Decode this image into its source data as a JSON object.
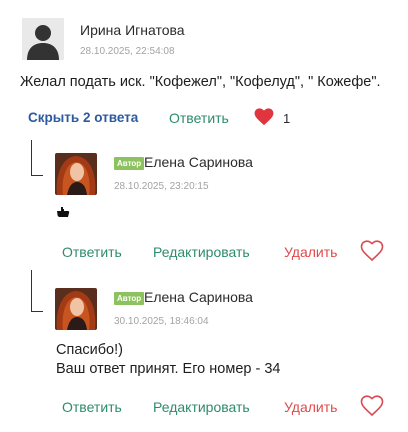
{
  "comment": {
    "author": "Ирина Игнатова",
    "timestamp": "28.10.2025, 22:54:08",
    "text": "Желал подать иск. \"Кофежел\", \"Кофелуд\", \" Кожефе\".",
    "hide_replies_label": "Скрыть 2 ответа",
    "reply_label": "Ответить",
    "like_count": "1",
    "like_color": "#e0353f"
  },
  "replies": [
    {
      "badge": "Автор",
      "author": "Елена Саринова",
      "timestamp": "28.10.2025, 23:20:15",
      "text_icon": "pointing-hand-icon",
      "reply_label": "Ответить",
      "edit_label": "Редактировать",
      "delete_label": "Удалить"
    },
    {
      "badge": "Автор",
      "author": "Елена Саринова",
      "timestamp": "30.10.2025, 18:46:04",
      "text_line1": "Спасибо!)",
      "text_line2": "Ваш ответ принят. Его номер - 34",
      "reply_label": "Ответить",
      "edit_label": "Редактировать",
      "delete_label": "Удалить"
    }
  ],
  "colors": {
    "link_blue": "#2c5aa0",
    "action_green": "#2e8b6e",
    "delete_red": "#e04a4a",
    "badge_green": "#8dc35f"
  }
}
